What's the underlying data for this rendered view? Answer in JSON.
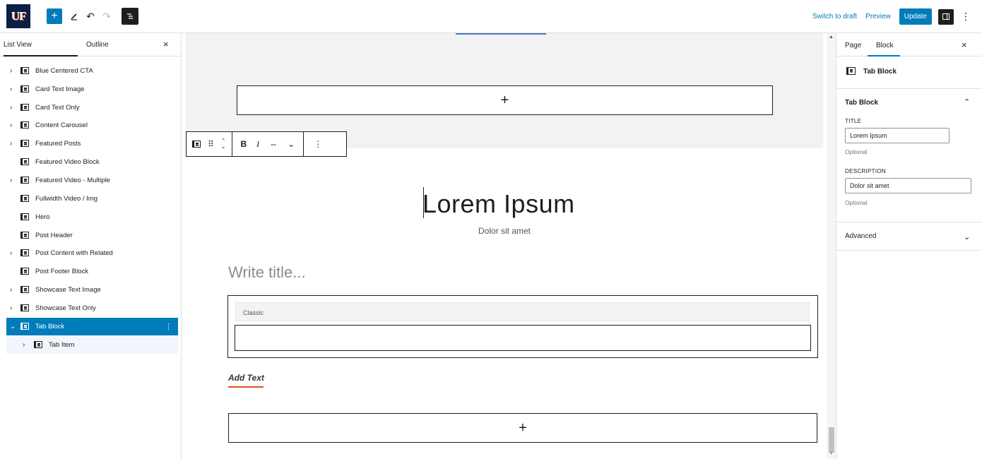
{
  "topbar": {
    "logo": "UF",
    "add_icon": "+",
    "undo_icon": "↶",
    "redo_icon": "↷",
    "switch_to_draft": "Switch to draft",
    "preview": "Preview",
    "update": "Update",
    "more_icon": "⋮"
  },
  "left_panel": {
    "tab_list": "List View",
    "tab_outline": "Outline",
    "close": "×",
    "items": [
      {
        "label": "Blue Centered CTA",
        "chevron": "›"
      },
      {
        "label": "Card Text Image",
        "chevron": "›"
      },
      {
        "label": "Card Text Only",
        "chevron": "›"
      },
      {
        "label": "Content Carousel",
        "chevron": "›"
      },
      {
        "label": "Featured Posts",
        "chevron": "›"
      },
      {
        "label": "Featured Video Block",
        "chevron": ""
      },
      {
        "label": "Featured Video - Multiple",
        "chevron": "›"
      },
      {
        "label": "Fullwidth Video / Img",
        "chevron": ""
      },
      {
        "label": "Hero",
        "chevron": ""
      },
      {
        "label": "Post Header",
        "chevron": ""
      },
      {
        "label": "Post Content with Related",
        "chevron": "›"
      },
      {
        "label": "Post Footer Block",
        "chevron": ""
      },
      {
        "label": "Showcase Text Image",
        "chevron": "›"
      },
      {
        "label": "Showcase Text Only",
        "chevron": "›"
      },
      {
        "label": "Tab Block",
        "chevron": "⌄"
      },
      {
        "label": "Tab Item",
        "chevron": "›"
      }
    ],
    "selected_more": "⋮"
  },
  "canvas": {
    "appender_plus": "+",
    "toolbar": {
      "bold": "B",
      "italic": "I",
      "link": "⇔",
      "more_rich": "⌄",
      "options": "⋮",
      "drag": "⠿",
      "move_up": "⌃",
      "move_down": "⌄"
    },
    "heading": "Lorem Ipsum",
    "subheading": "Dolor sit amet",
    "write_title_placeholder": "Write title...",
    "classic_label": "Classic",
    "add_text": "Add Text"
  },
  "right_panel": {
    "tab_page": "Page",
    "tab_block": "Block",
    "close": "×",
    "block_card_title": "Tab Block",
    "section_title": "Tab Block",
    "section_chevron": "⌃",
    "title_label": "TITLE",
    "title_value": "Lorem Ipsum",
    "title_help": "Optional",
    "description_label": "DESCRIPTION",
    "description_value": "Dolor sit amet",
    "description_help": "Optional",
    "advanced": "Advanced",
    "advanced_chevron": "⌄"
  },
  "colors": {
    "accent": "#007cba",
    "dark": "#1e1e1e",
    "underline": "#e2511f",
    "logo_bg": "#0a1f44"
  }
}
